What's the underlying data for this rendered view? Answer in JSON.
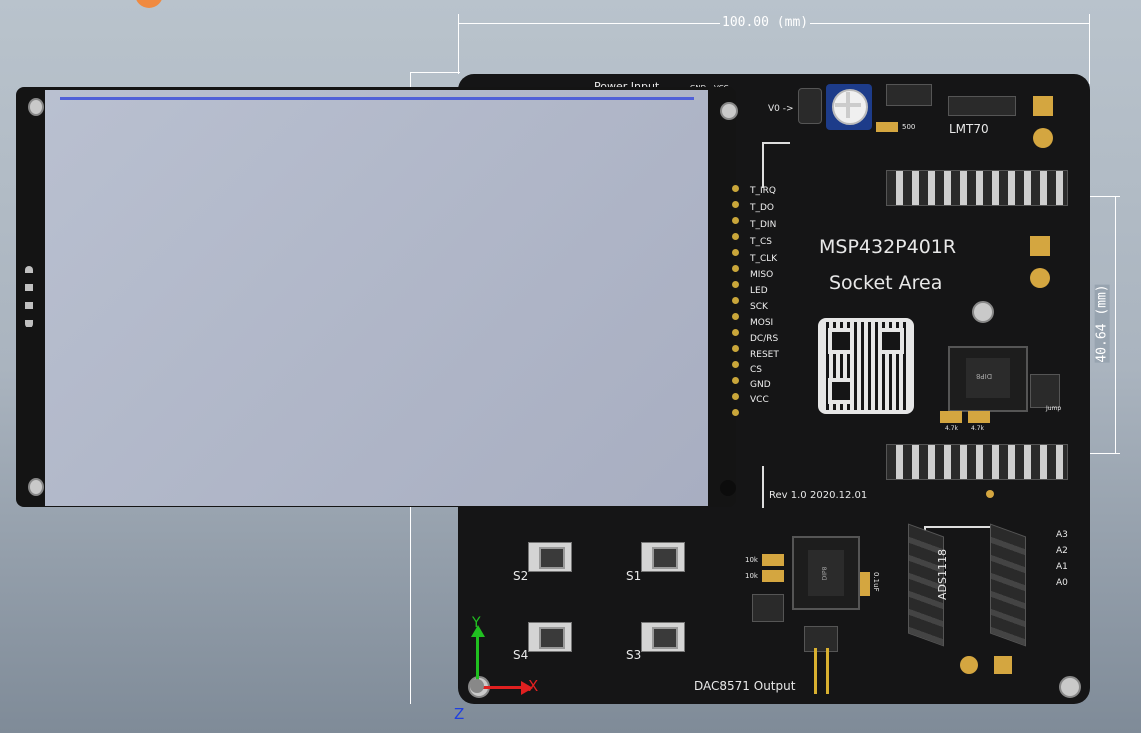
{
  "dimensions": {
    "width_label": "100.00 (mm)",
    "height_label": "40.64 (mm)"
  },
  "board": {
    "title_line1": "MSP432P401R",
    "title_line2": "Socket Area",
    "power_label": "Power Input",
    "vcc_label": "VCC",
    "gnd_label": "GND",
    "v0_label": "V0 ->",
    "pot_value": "500",
    "lmt_label": "LMT70",
    "revision": "Rev 1.0",
    "date": "2020.12.01",
    "dip_label": "DIP8",
    "jump_label": "Jump",
    "resistors": [
      "4.7k",
      "4.7k"
    ],
    "ads_label": "ADS1118",
    "analog_pins": [
      "A3",
      "A2",
      "A1",
      "A0"
    ],
    "dac_label": "DAC8571 Output",
    "res_10k": [
      "10k",
      "10k"
    ],
    "cap_label": "0.1uF",
    "buttons": [
      "S2",
      "S1",
      "S4",
      "S3"
    ]
  },
  "lcd_pins": [
    "T_IRQ",
    "T_DO",
    "T_DIN",
    "T_CS",
    "T_CLK",
    "MISO",
    "LED",
    "SCK",
    "MOSI",
    "DC/RS",
    "RESET",
    "CS",
    "GND",
    "VCC"
  ],
  "axes": {
    "x": "X",
    "y": "Y",
    "z": "Z"
  },
  "colors": {
    "board": "#151516",
    "pad": "#d4a640",
    "screen_line": "#5060d8",
    "x_axis": "#e02020",
    "y_axis": "#20c020",
    "z_axis": "#2040e0"
  }
}
